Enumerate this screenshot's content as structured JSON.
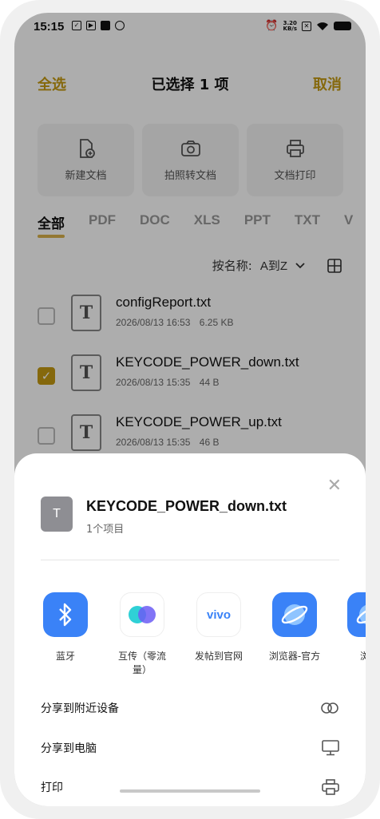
{
  "status": {
    "time": "15:15",
    "netspeed_value": "3.20",
    "netspeed_unit": "KB/s"
  },
  "header": {
    "select_all": "全选",
    "title": "已选择 1 项",
    "cancel": "取消"
  },
  "tools": [
    {
      "label": "新建文档",
      "icon": "new-doc-icon"
    },
    {
      "label": "拍照转文档",
      "icon": "camera-icon"
    },
    {
      "label": "文档打印",
      "icon": "printer-icon"
    }
  ],
  "tabs": [
    "全部",
    "PDF",
    "DOC",
    "XLS",
    "PPT",
    "TXT",
    "V"
  ],
  "sort": {
    "prefix": "按名称:",
    "value": "A到Z"
  },
  "files": [
    {
      "name": "configReport.txt",
      "date": "2026/08/13 16:53",
      "size": "6.25 KB",
      "checked": false
    },
    {
      "name": "KEYCODE_POWER_down.txt",
      "date": "2026/08/13 15:35",
      "size": "44 B",
      "checked": true
    },
    {
      "name": "KEYCODE_POWER_up.txt",
      "date": "2026/08/13 15:35",
      "size": "46 B",
      "checked": false
    }
  ],
  "sheet": {
    "icon_letter": "T",
    "file_name": "KEYCODE_POWER_down.txt",
    "item_count": "1个项目",
    "apps": [
      {
        "label": "蓝牙",
        "icon": "bluetooth-icon",
        "color": "#3a82f7"
      },
      {
        "label": "互传（零流量）",
        "icon": "transfer-icon",
        "color": "#ffffff"
      },
      {
        "label": "发帖到官网",
        "icon": "vivo-icon",
        "color": "#ffffff"
      },
      {
        "label": "浏览器-官方",
        "icon": "browser-icon",
        "color": "#3a82f7"
      },
      {
        "label": "浏览",
        "icon": "browser-icon",
        "color": "#3a82f7"
      }
    ],
    "rows": [
      {
        "label": "分享到附近设备",
        "icon": "link-icon"
      },
      {
        "label": "分享到电脑",
        "icon": "monitor-icon"
      },
      {
        "label": "打印",
        "icon": "printer-icon"
      }
    ]
  },
  "colors": {
    "accent": "#c49a12",
    "app_blue": "#3a82f7"
  }
}
